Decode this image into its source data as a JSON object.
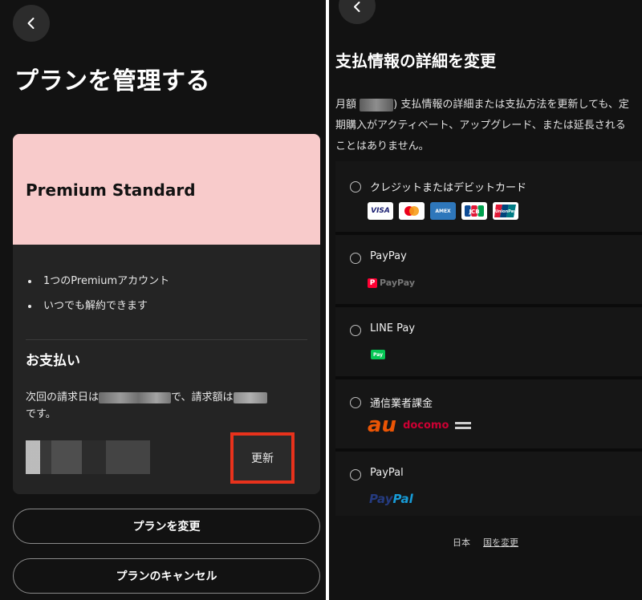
{
  "left": {
    "title": "プランを管理する",
    "plan_name": "Premium Standard",
    "features": [
      "1つのPremiumアカウント",
      "いつでも解約できます"
    ],
    "payment_heading": "お支払い",
    "next_billing_prefix": "次回の請求日は",
    "next_billing_middle": "で、請求額は",
    "next_billing_suffix": "です。",
    "update_label": "更新",
    "change_plan_label": "プランを変更",
    "cancel_plan_label": "プランのキャンセル"
  },
  "right": {
    "title": "支払情報の詳細を変更",
    "desc_prefix": "月額",
    "desc_text": ") 支払情報の詳細または支払方法を更新しても、定期購入がアクティベート、アップグレード、または延長されることはありません。",
    "options": [
      {
        "label": "クレジットまたはデビットカード"
      },
      {
        "label": "PayPay",
        "logo_text": "PayPay"
      },
      {
        "label": "LINE Pay",
        "logo_text": "Pay"
      },
      {
        "label": "通信業者課金",
        "logo_au": "au",
        "logo_docomo": "docomo"
      },
      {
        "label": "PayPal",
        "logo_pay": "Pay",
        "logo_pal": "Pal"
      }
    ],
    "card_brands": [
      "VISA",
      "mastercard",
      "AMEX",
      "JCB",
      "UnionPay"
    ],
    "footer_country": "日本",
    "footer_change_country": "国を変更"
  },
  "colors": {
    "background": "#121212",
    "card": "#242424",
    "plan_header": "#f8cbcb",
    "highlight_border": "#e8321c"
  }
}
